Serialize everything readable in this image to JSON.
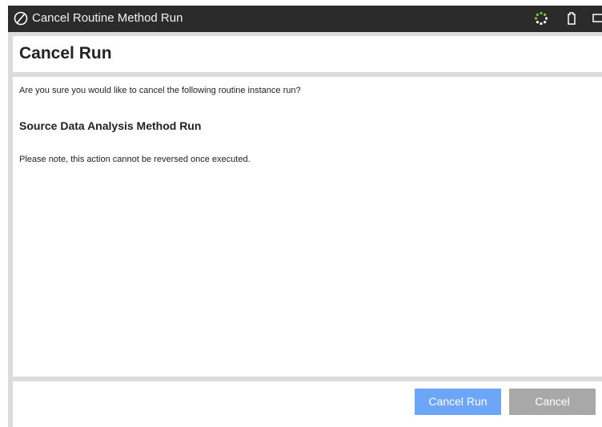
{
  "window": {
    "title": "Cancel Routine Method Run",
    "icons": [
      "strikethrough-circle-icon",
      "spinner-icon",
      "clipboard-icon",
      "window-more-icon"
    ]
  },
  "dialog": {
    "heading": "Cancel Run",
    "question": "Are you sure you would like to cancel the following routine instance run?",
    "run_name": "Source Data Analysis Method Run",
    "note": "Please note, this action cannot be reversed once executed."
  },
  "footer": {
    "confirm_label": "Cancel Run",
    "cancel_label": "Cancel"
  },
  "colors": {
    "titlebar": "#2b2b2b",
    "primary_button": "#6ea6f7",
    "secondary_button": "#a8a8a8",
    "backdrop": "#dcdcdc"
  }
}
